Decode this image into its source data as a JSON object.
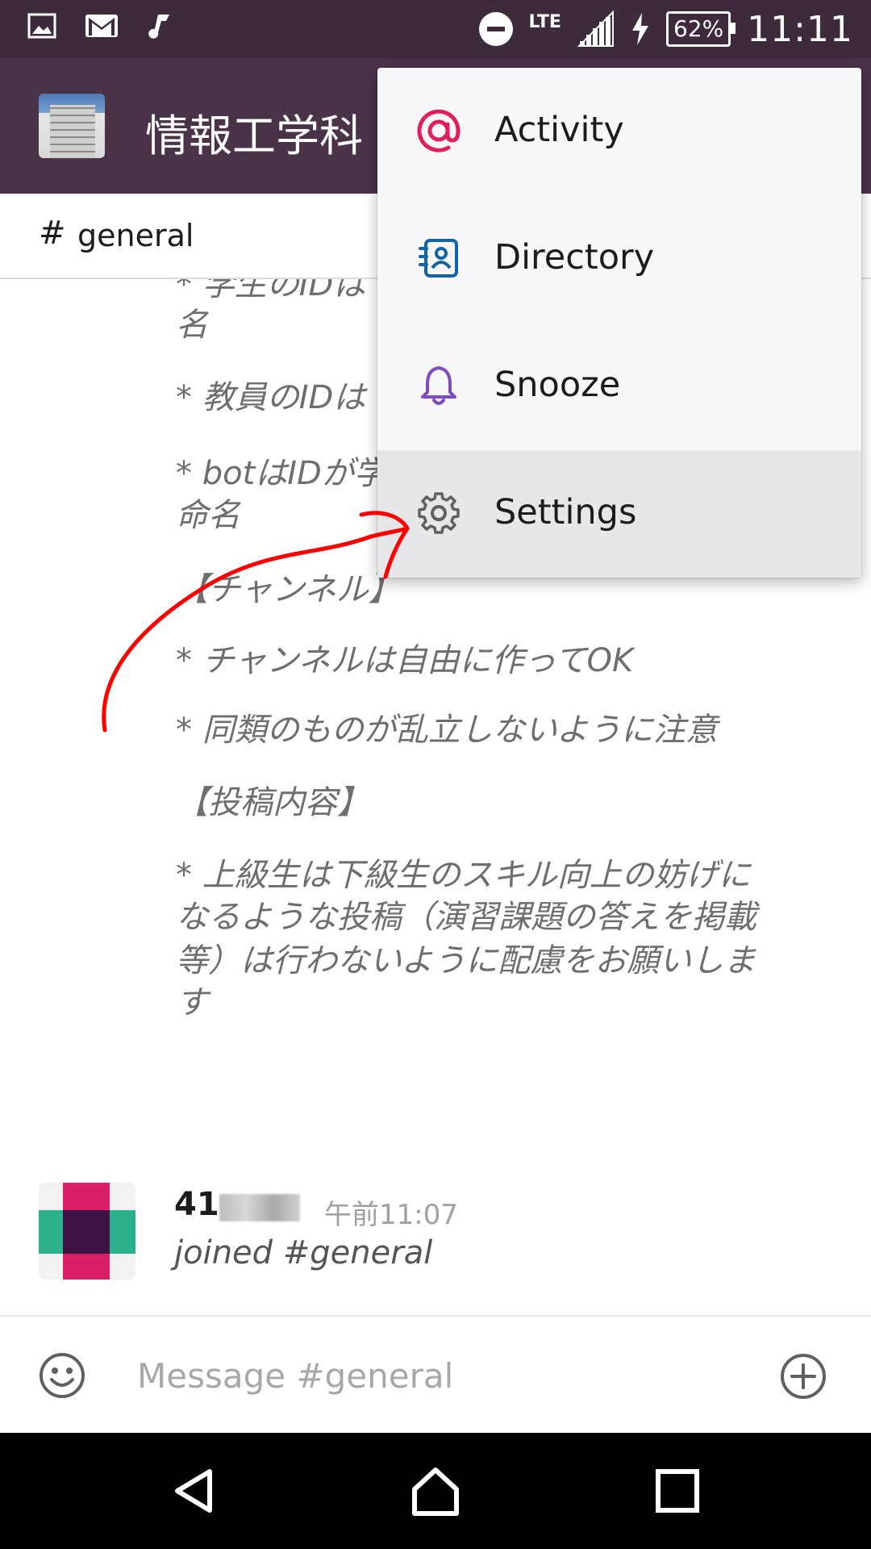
{
  "status_bar": {
    "lte": "LTE",
    "battery": "62%",
    "time": "11:11"
  },
  "header": {
    "team_name": "情報工学科"
  },
  "channel": {
    "hash": "#",
    "name": "general"
  },
  "message_lines": [
    "* 学生のIDは",
    "名",
    "* 教員のIDは",
    "* botはIDが学",
    "命名",
    "【チャンネル】",
    "* チャンネルは自由に作ってOK",
    "* 同類のものが乱立しないように注意",
    "【投稿内容】",
    "* 上級生は下級生のスキル向上の妨げに",
    "なるような投稿（演習課題の答えを掲載",
    "等）は行わないように配慮をお願いしま",
    "す"
  ],
  "join_message": {
    "username": "41",
    "timestamp": "午前11:07",
    "text": "joined #general"
  },
  "composer": {
    "placeholder": "Message #general"
  },
  "menu": {
    "items": [
      {
        "label": "Activity",
        "icon": "at-icon",
        "color": "#e01e5a"
      },
      {
        "label": "Directory",
        "icon": "directory-icon",
        "color": "#1264a3"
      },
      {
        "label": "Snooze",
        "icon": "bell-icon",
        "color": "#7c4dbb"
      },
      {
        "label": "Settings",
        "icon": "gear-icon",
        "color": "#616061"
      }
    ]
  },
  "colors": {
    "header_bg": "#4a3347",
    "annotation": "#ff0000"
  }
}
